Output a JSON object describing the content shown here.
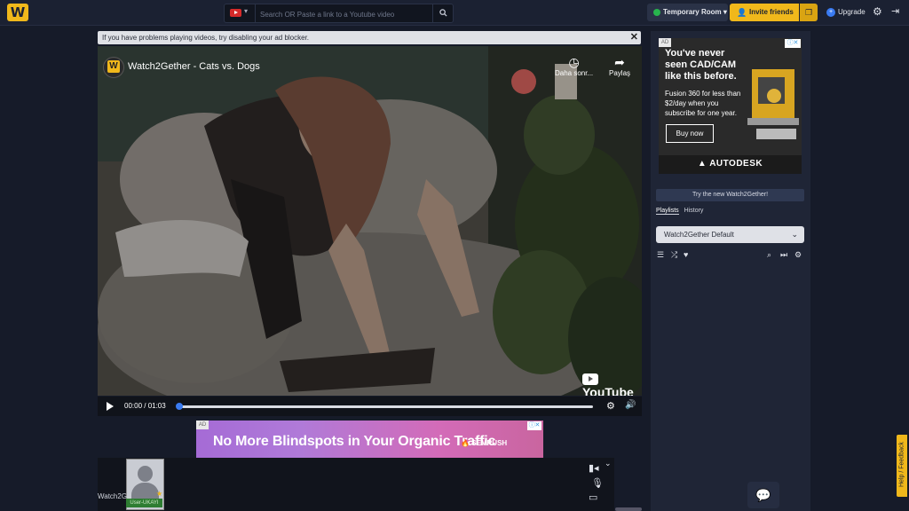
{
  "topbar": {
    "logo_letter": "W",
    "search_placeholder": "Search OR Paste a link to a Youtube video",
    "room_label": "Temporary Room",
    "room_caret": "▾",
    "invite_label": "Invite friends",
    "upgrade_label": "Upgrade"
  },
  "ad_notice": {
    "text": "If you have problems playing videos, try disabling your ad blocker.",
    "close": "✕"
  },
  "video": {
    "title": "Watch2Gether - Cats vs. Dogs",
    "watch_later_label": "Daha sonr...",
    "share_label": "Paylaş",
    "platform_mark": "YouTube",
    "time": "00:00 / 01:03",
    "progress": 0.0
  },
  "banner_ad": {
    "ad_label": "AD",
    "headline": "No More Blindspots in Your Organic Traffic",
    "brand": "SEMRUSH"
  },
  "webcam": {
    "user_name": "User-UKAYI"
  },
  "chat_label": "Watch2G",
  "sidebar": {
    "ad": {
      "ad_label": "AD",
      "headline": "You've never seen CAD/CAM like this before.",
      "body": "Fusion 360 for less than $2/day when you subscribe for one year.",
      "cta": "Buy now",
      "brand": "AUTODESK"
    },
    "try_new": "Try the new Watch2Gether!",
    "tabs": [
      {
        "label": "Playlists",
        "active": true
      },
      {
        "label": "History",
        "active": false
      }
    ],
    "playlist_selected": "Watch2Gether Default"
  },
  "feedback_label": "Help / Feedback",
  "colors": {
    "accent": "#f0b81b",
    "background": "#161b29",
    "panel": "#1f2536",
    "online": "#27b44d",
    "progress": "#3a7bf2"
  }
}
